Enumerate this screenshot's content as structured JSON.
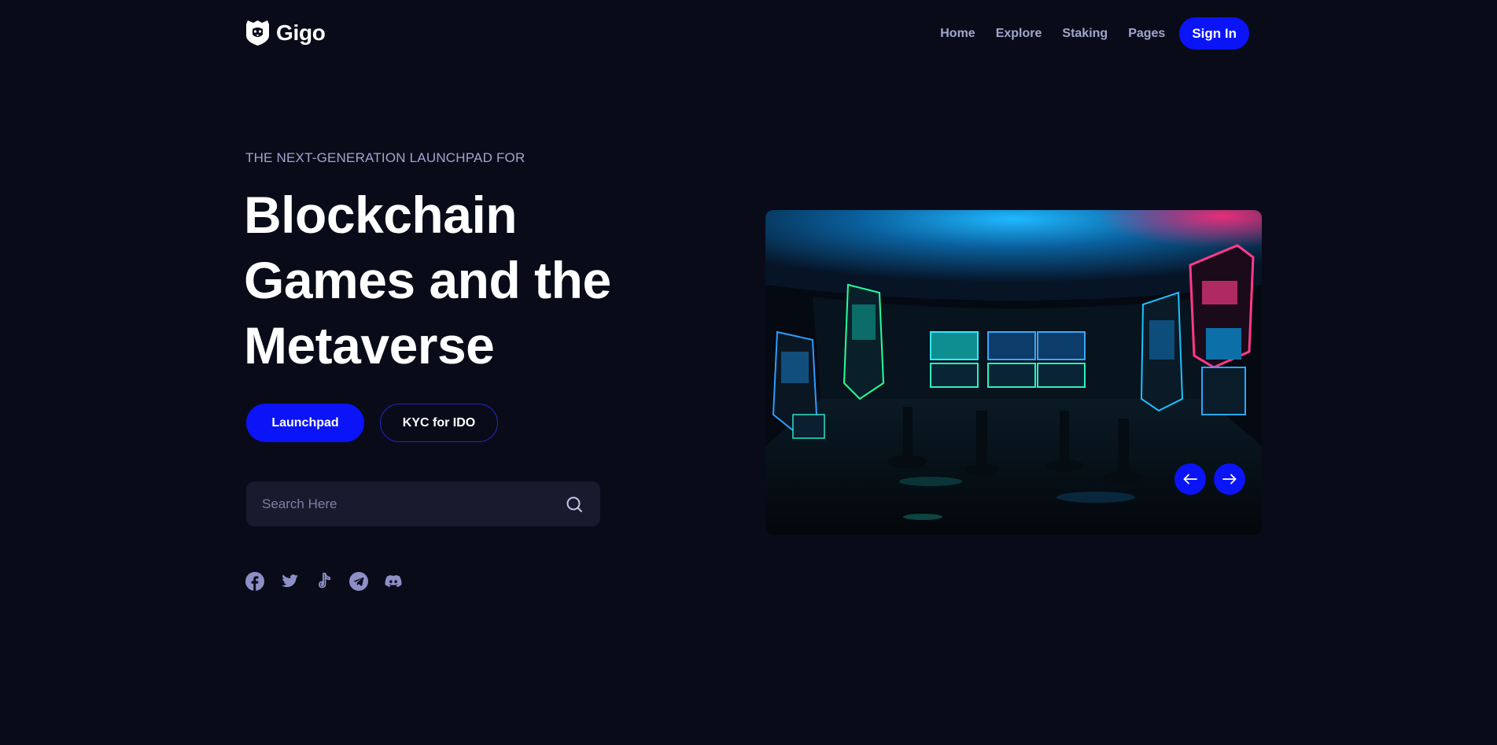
{
  "header": {
    "brand": "Gigo",
    "logo_icon": "lion-shield-icon",
    "nav": [
      {
        "label": "Home"
      },
      {
        "label": "Explore"
      },
      {
        "label": "Staking"
      },
      {
        "label": "Pages"
      }
    ],
    "signin_label": "Sign In"
  },
  "hero": {
    "eyebrow": "THE NEXT-GENERATION LAUNCHPAD FOR",
    "title_lines": [
      "Blockchain",
      "Games and the",
      "Metaverse"
    ],
    "primary_button": "Launchpad",
    "secondary_button": "KYC for IDO",
    "search_placeholder": "Search Here",
    "socials": [
      "facebook-icon",
      "twitter-icon",
      "tiktok-icon",
      "telegram-icon",
      "discord-icon"
    ],
    "slider": {
      "image": "neon-arcade-room",
      "prev_icon": "arrow-left-icon",
      "next_icon": "arrow-right-icon"
    }
  },
  "colors": {
    "background": "#0a0b19",
    "accent": "#0a14f7",
    "muted_text": "#a2a6cc",
    "input_bg": "#181a2e"
  }
}
